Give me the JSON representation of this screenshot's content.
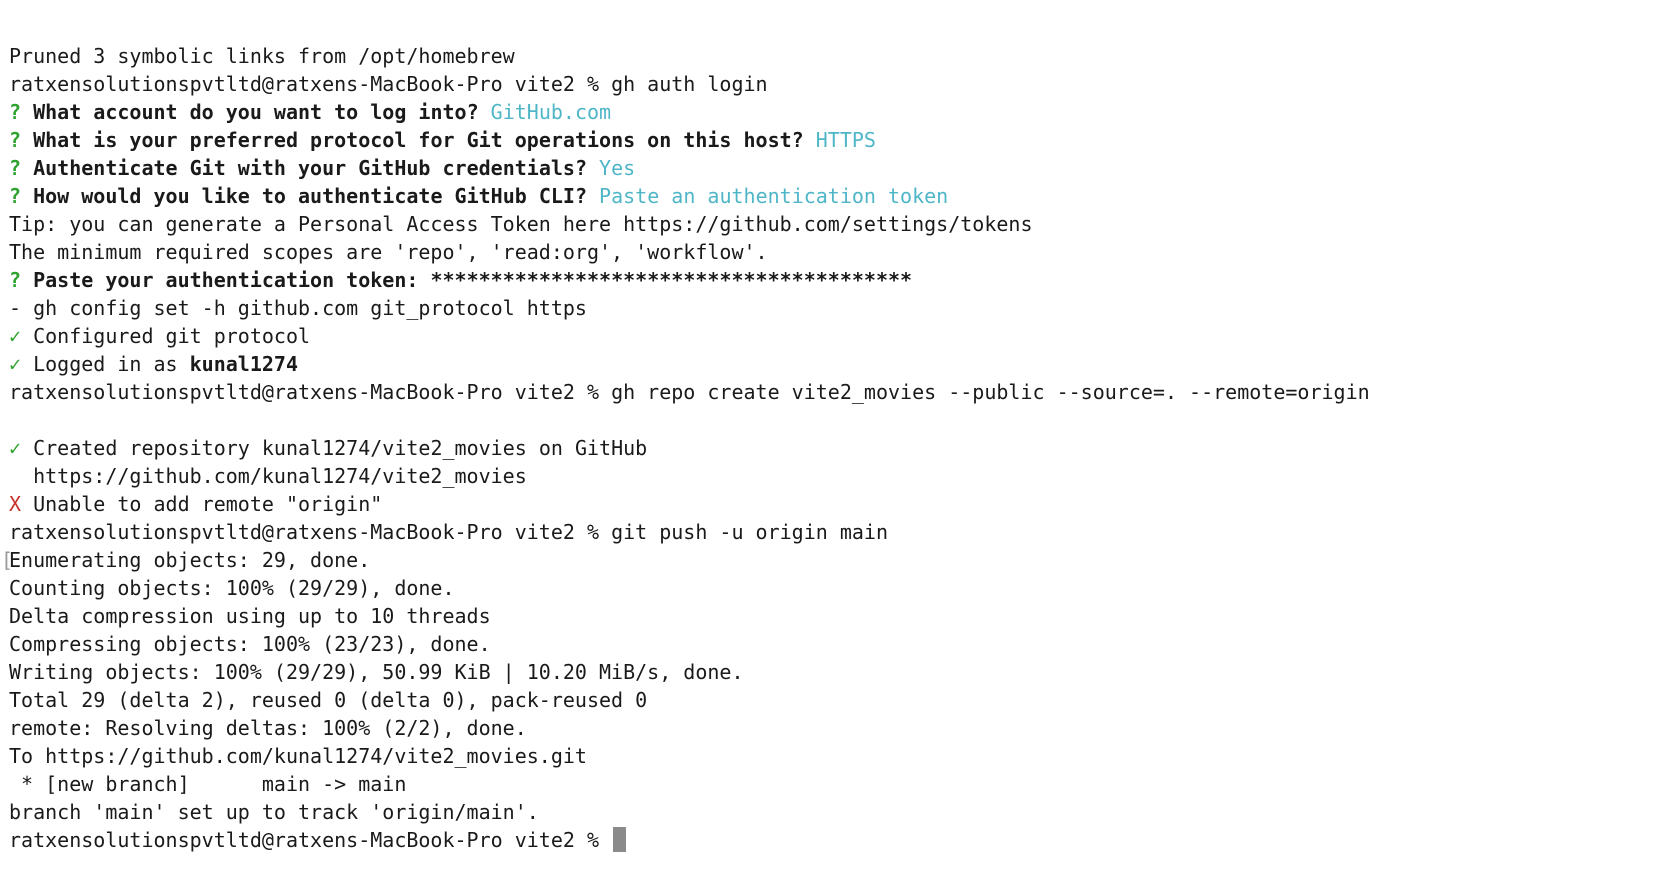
{
  "terminal": {
    "prompt": "ratxensolutionspvtltd@ratxens-MacBook-Pro vite2 % ",
    "lines": [
      {
        "text": "Pruned 3 symbolic links from /opt/homebrew"
      },
      {
        "cmd": "gh auth login"
      },
      {
        "question": "What account do you want to log into?",
        "answer": "GitHub.com"
      },
      {
        "question": "What is your preferred protocol for Git operations on this host?",
        "answer": "HTTPS"
      },
      {
        "question": "Authenticate Git with your GitHub credentials?",
        "answer": "Yes"
      },
      {
        "question": "How would you like to authenticate GitHub CLI?",
        "answer": "Paste an authentication token"
      },
      {
        "text": "Tip: you can generate a Personal Access Token here https://github.com/settings/tokens"
      },
      {
        "text": "The minimum required scopes are 'repo', 'read:org', 'workflow'."
      },
      {
        "question": "Paste your authentication token:",
        "answer": "****************************************"
      },
      {
        "text": "- gh config set -h github.com git_protocol https"
      },
      {
        "check": "Configured git protocol"
      },
      {
        "check_prefix": "Logged in as ",
        "check_bold": "kunal1274"
      },
      {
        "cmd": "gh repo create vite2_movies --public --source=. --remote=origin"
      },
      {
        "text": ""
      },
      {
        "check": "Created repository kunal1274/vite2_movies on GitHub"
      },
      {
        "text": "  https://github.com/kunal1274/vite2_movies"
      },
      {
        "error": "Unable to add remote \"origin\""
      },
      {
        "cmd": "git push -u origin main"
      },
      {
        "text": "Enumerating objects: 29, done."
      },
      {
        "text": "Counting objects: 100% (29/29), done."
      },
      {
        "text": "Delta compression using up to 10 threads"
      },
      {
        "text": "Compressing objects: 100% (23/23), done."
      },
      {
        "text": "Writing objects: 100% (29/29), 50.99 KiB | 10.20 MiB/s, done."
      },
      {
        "text": "Total 29 (delta 2), reused 0 (delta 0), pack-reused 0"
      },
      {
        "text": "remote: Resolving deltas: 100% (2/2), done."
      },
      {
        "text": "To https://github.com/kunal1274/vite2_movies.git"
      },
      {
        "text": " * [new branch]      main -> main"
      },
      {
        "text": "branch 'main' set up to track 'origin/main'."
      },
      {
        "cmd": ""
      }
    ],
    "symbols": {
      "question": "?",
      "check": "✓",
      "error": "X"
    },
    "colors": {
      "question_mark": "#2fa32f",
      "check_mark": "#2fa32f",
      "error_mark": "#c7312b",
      "answer": "#4fb6c8",
      "text": "#1a1a1a",
      "background": "#ffffff",
      "cursor": "#8a8a8a"
    }
  }
}
